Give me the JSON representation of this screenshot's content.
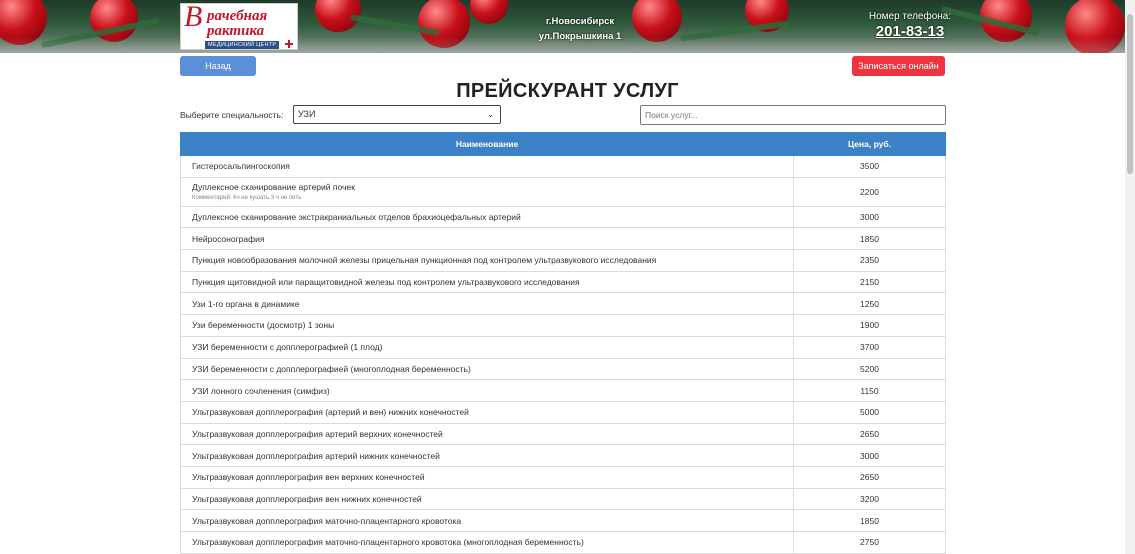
{
  "header": {
    "city": "г.Новосибирск",
    "street": "ул.Покрышкина 1",
    "phone_label": "Номер телефона:",
    "phone_number": "201-83-13",
    "logo_line1": "рачебная",
    "logo_line2": "рактика",
    "logo_sub": "МЕДИЦИНСКИЙ ЦЕНТР"
  },
  "actions": {
    "back_label": "Назад",
    "signup_label": "Записаться онлайн"
  },
  "page_title": "ПРЕЙСКУРАНТ УСЛУГ",
  "filter": {
    "label": "Выберите специальность:",
    "selected": "УЗИ",
    "search_placeholder": "Поиск услуг..."
  },
  "table": {
    "headers": [
      "Наименование",
      "Цена, руб."
    ],
    "rows": [
      {
        "name": "Гистеросальпингоскопия",
        "price": "3500"
      },
      {
        "name": "Дуплексное сканирование артерий почек",
        "comment": "Комментарий: 6ч не кушать,3 ч не пить",
        "price": "2200"
      },
      {
        "name": "Дуплексное сканирование экстракраниальных отделов брахиоцефальных артерий",
        "price": "3000"
      },
      {
        "name": "Нейросонография",
        "price": "1850"
      },
      {
        "name": "Пункция новообразования молочной железы прицельная пункционная под контролем ультразвукового исследования",
        "price": "2350"
      },
      {
        "name": "Пункция щитовидной или паращитовидной железы под контролем ультразвукового исследования",
        "price": "2150"
      },
      {
        "name": "Узи 1-го органа в динамике",
        "price": "1250"
      },
      {
        "name": "Узи беременности (досмотр) 1 зоны",
        "price": "1900"
      },
      {
        "name": "УЗИ беременности с допплерографией (1 плод)",
        "price": "3700"
      },
      {
        "name": "УЗИ беременности с допплерографией (многоплодная беременность)",
        "price": "5200"
      },
      {
        "name": "УЗИ лонного сочленения (симфиз)",
        "price": "1150"
      },
      {
        "name": "Ультразвуковая допплерография (артерий и вен) нижних конечностей",
        "price": "5000"
      },
      {
        "name": "Ультразвуковая допплерография артерий верхних конечностей",
        "price": "2650"
      },
      {
        "name": "Ультразвуковая допплерография артерий нижних конечностей",
        "price": "3000"
      },
      {
        "name": "Ультразвуковая допплерография вен верхних конечностей",
        "price": "2650"
      },
      {
        "name": "Ультразвуковая допплерография вен нижних конечностей",
        "price": "3200"
      },
      {
        "name": "Ультразвуковая допплерография маточно-плацентарного кровотока",
        "price": "1850"
      },
      {
        "name": "Ультразвуковая допплерография маточно-плацентарного кровотока (многоплодная беременность)",
        "price": "2750"
      }
    ]
  },
  "colors": {
    "header_blue": "#3a82c5",
    "back_button": "#5b8fd7",
    "signup_button": "#ef3440",
    "brand_red": "#c4162a"
  }
}
